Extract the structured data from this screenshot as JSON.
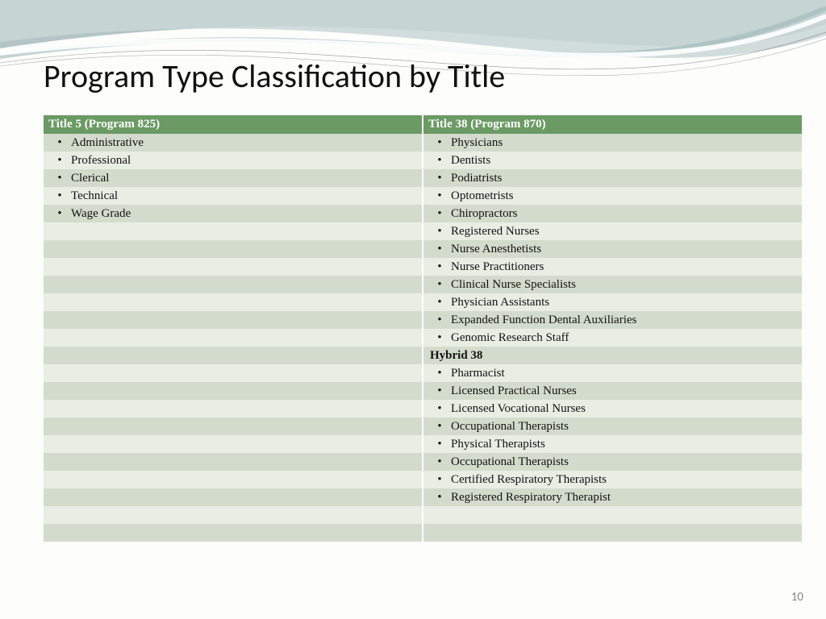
{
  "title": "Program Type Classification by Title",
  "page_number": "10",
  "headers": {
    "left": "Title 5  (Program 825)",
    "right": "Title 38  (Program 870)"
  },
  "rows": [
    {
      "left": {
        "type": "bullet",
        "text": "Administrative"
      },
      "right": {
        "type": "bullet",
        "text": "Physicians"
      }
    },
    {
      "left": {
        "type": "bullet",
        "text": "Professional"
      },
      "right": {
        "type": "bullet",
        "text": "Dentists"
      }
    },
    {
      "left": {
        "type": "bullet",
        "text": "Clerical"
      },
      "right": {
        "type": "bullet",
        "text": "Podiatrists"
      }
    },
    {
      "left": {
        "type": "bullet",
        "text": "Technical"
      },
      "right": {
        "type": "bullet",
        "text": "Optometrists"
      }
    },
    {
      "left": {
        "type": "bullet",
        "text": "Wage Grade"
      },
      "right": {
        "type": "bullet",
        "text": "Chiropractors"
      }
    },
    {
      "left": {
        "type": "empty"
      },
      "right": {
        "type": "bullet",
        "text": "Registered Nurses"
      }
    },
    {
      "left": {
        "type": "empty"
      },
      "right": {
        "type": "bullet",
        "text": "Nurse Anesthetists"
      }
    },
    {
      "left": {
        "type": "empty"
      },
      "right": {
        "type": "bullet",
        "text": "Nurse Practitioners"
      }
    },
    {
      "left": {
        "type": "empty"
      },
      "right": {
        "type": "bullet",
        "text": "Clinical Nurse Specialists"
      }
    },
    {
      "left": {
        "type": "empty"
      },
      "right": {
        "type": "bullet",
        "text": "Physician Assistants"
      }
    },
    {
      "left": {
        "type": "empty"
      },
      "right": {
        "type": "bullet",
        "text": "Expanded Function Dental Auxiliaries"
      }
    },
    {
      "left": {
        "type": "empty"
      },
      "right": {
        "type": "bullet",
        "text": "Genomic Research Staff"
      }
    },
    {
      "left": {
        "type": "empty"
      },
      "right": {
        "type": "subhead",
        "text": "Hybrid 38"
      }
    },
    {
      "left": {
        "type": "empty"
      },
      "right": {
        "type": "bullet",
        "text": "Pharmacist"
      }
    },
    {
      "left": {
        "type": "empty"
      },
      "right": {
        "type": "bullet",
        "text": "Licensed Practical Nurses"
      }
    },
    {
      "left": {
        "type": "empty"
      },
      "right": {
        "type": "bullet",
        "text": "Licensed Vocational Nurses"
      }
    },
    {
      "left": {
        "type": "empty"
      },
      "right": {
        "type": "bullet",
        "text": "Occupational Therapists"
      }
    },
    {
      "left": {
        "type": "empty"
      },
      "right": {
        "type": "bullet",
        "text": "Physical Therapists"
      }
    },
    {
      "left": {
        "type": "empty"
      },
      "right": {
        "type": "bullet",
        "text": "Occupational Therapists"
      }
    },
    {
      "left": {
        "type": "empty"
      },
      "right": {
        "type": "bullet",
        "text": "Certified Respiratory Therapists"
      }
    },
    {
      "left": {
        "type": "empty"
      },
      "right": {
        "type": "bullet",
        "text": "Registered Respiratory Therapist"
      }
    },
    {
      "left": {
        "type": "empty"
      },
      "right": {
        "type": "empty"
      }
    },
    {
      "left": {
        "type": "empty"
      },
      "right": {
        "type": "empty"
      }
    }
  ]
}
